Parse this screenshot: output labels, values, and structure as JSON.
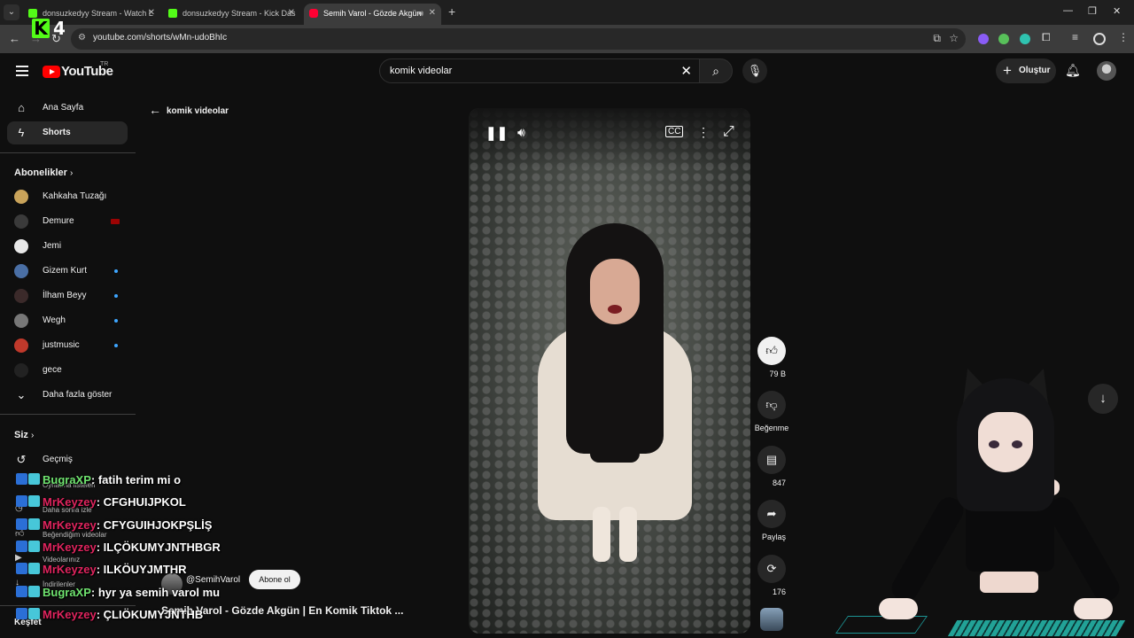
{
  "browser": {
    "tabs": [
      {
        "title": "donsuzkedyy Stream - Watch L",
        "favicon": "kick-icon"
      },
      {
        "title": "donsuzkedyy Stream - Kick Das",
        "favicon": "kick-icon"
      },
      {
        "title": "Semih Varol - Gözde Akgün",
        "favicon": "youtube-icon",
        "audio": true
      }
    ],
    "url": "youtube.com/shorts/wMn-udoBhIc"
  },
  "overlay": {
    "kick_count": "4"
  },
  "youtube": {
    "logo_text": "YouTube",
    "country_code": "TR",
    "search_query": "komik videolar",
    "create_label": "Oluştur"
  },
  "sidebar": {
    "main": [
      {
        "label": "Ana Sayfa",
        "icon": "home-icon"
      },
      {
        "label": "Shorts",
        "icon": "shorts-icon"
      }
    ],
    "subscriptions_heading": "Abonelikler",
    "subscriptions": [
      {
        "label": "Kahkaha Tuzağı",
        "color": "#c9a35a",
        "indicator": ""
      },
      {
        "label": "Demure",
        "color": "#3a3a3a",
        "indicator": "live"
      },
      {
        "label": "Jemi",
        "color": "#e8e8e8",
        "indicator": ""
      },
      {
        "label": "Gizem Kurt",
        "color": "#4a6fa5",
        "indicator": "new"
      },
      {
        "label": "İlham Beyy",
        "color": "#3b2a2a",
        "indicator": "new"
      },
      {
        "label": "Wegh",
        "color": "#777777",
        "indicator": "new"
      },
      {
        "label": "justmusic",
        "color": "#c0392b",
        "indicator": "new"
      },
      {
        "label": "gece",
        "color": "#222222",
        "indicator": ""
      }
    ],
    "show_more": "Daha fazla göster",
    "you_heading": "Siz",
    "you_items": [
      {
        "label": "Geçmiş",
        "icon": "history-icon"
      },
      {
        "label": "Oynatma listeleri",
        "icon": "playlist-icon"
      },
      {
        "label": "Daha sonra izle",
        "icon": "watch-later-icon"
      },
      {
        "label": "Beğendiğim videolar",
        "icon": "like-icon"
      },
      {
        "label": "Videolarınız",
        "icon": "video-icon"
      },
      {
        "label": "İndirilenler",
        "icon": "download-icon"
      }
    ],
    "explore_label": "Keşfet"
  },
  "short": {
    "back_label": "komik videolar",
    "channel": "@SemihVarol",
    "subscribe_label": "Abone ol",
    "title": "Semih Varol - Gözde Akgün | En Komik Tiktok ...",
    "likes": "79 B",
    "dislike_label": "Beğenme",
    "comments": "847",
    "share_label": "Paylaş",
    "remix": "176"
  },
  "chat": [
    {
      "user": "BugraXP",
      "color": "#6fe36f",
      "message": ": fatih terim mi o"
    },
    {
      "user": "MrKeyzey",
      "color": "#e0245e",
      "message": ": CFGHUIJPKOL"
    },
    {
      "user": "MrKeyzey",
      "color": "#e0245e",
      "message": ": CFYGUIHJOKPŞLİŞ"
    },
    {
      "user": "MrKeyzey",
      "color": "#e0245e",
      "message": ": ILÇÖKUMYJNTHBGR"
    },
    {
      "user": "MrKeyzey",
      "color": "#e0245e",
      "message": ": ILKÖUYJMTHR"
    },
    {
      "user": "BugraXP",
      "color": "#6fe36f",
      "message": ": hyr ya semih varol mu"
    },
    {
      "user": "MrKeyzey",
      "color": "#e0245e",
      "message": ": ÇLIÖKUMYJNTHB"
    }
  ]
}
